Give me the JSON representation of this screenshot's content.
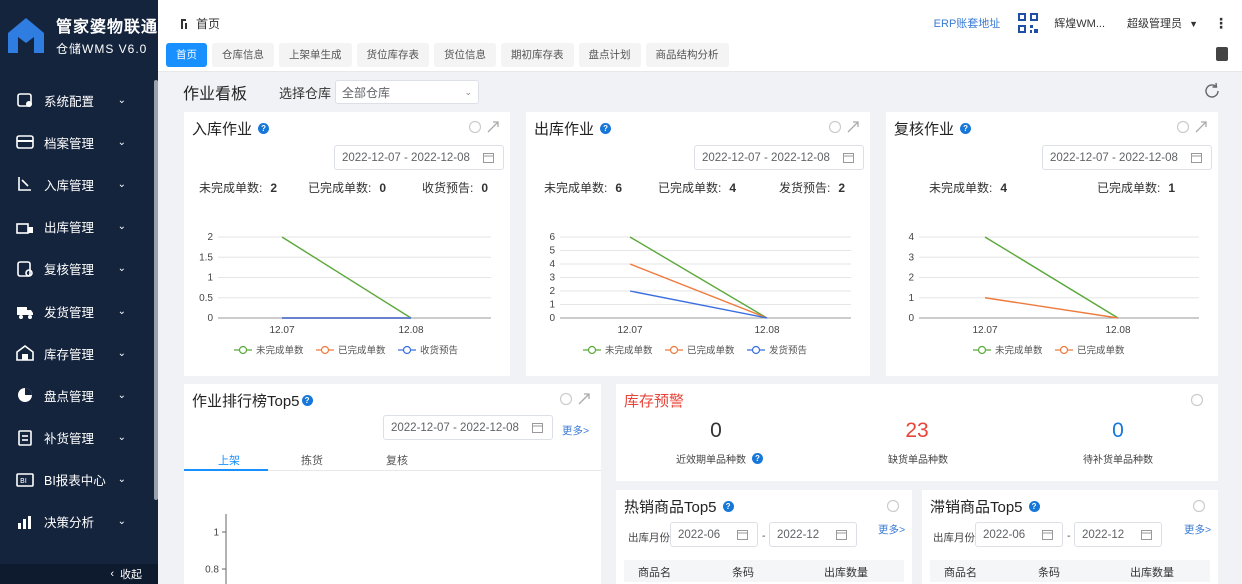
{
  "app": {
    "name": "管家婆物联通",
    "version": "仓储WMS V6.0"
  },
  "sidebar": {
    "items": [
      {
        "label": "系统配置",
        "icon": "settings-icon"
      },
      {
        "label": "档案管理",
        "icon": "archive-icon"
      },
      {
        "label": "入库管理",
        "icon": "inbound-icon"
      },
      {
        "label": "出库管理",
        "icon": "outbound-icon"
      },
      {
        "label": "复核管理",
        "icon": "review-icon"
      },
      {
        "label": "发货管理",
        "icon": "truck-icon"
      },
      {
        "label": "库存管理",
        "icon": "warehouse-icon"
      },
      {
        "label": "盘点管理",
        "icon": "pie-icon"
      },
      {
        "label": "补货管理",
        "icon": "replenish-icon"
      },
      {
        "label": "BI报表中心",
        "icon": "report-icon"
      },
      {
        "label": "决策分析",
        "icon": "bar-icon"
      }
    ],
    "collapse_label": "收起"
  },
  "header": {
    "breadcrumb": "首页",
    "erp_link": "ERP账套地址",
    "user_short": "辉煌WM...",
    "role": "超级管理员"
  },
  "tabs": [
    {
      "label": "首页",
      "active": true
    },
    {
      "label": "仓库信息"
    },
    {
      "label": "上架单生成"
    },
    {
      "label": "货位库存表"
    },
    {
      "label": "货位信息"
    },
    {
      "label": "期初库存表"
    },
    {
      "label": "盘点计划"
    },
    {
      "label": "商品结构分析"
    }
  ],
  "dashboard": {
    "title": "作业看板",
    "warehouse_label": "选择仓库",
    "warehouse_value": "全部仓库"
  },
  "inbound": {
    "title": "入库作业",
    "date_range": "2022-12-07 - 2022-12-08",
    "stats": [
      {
        "label": "未完成单数:",
        "value": "2"
      },
      {
        "label": "已完成单数:",
        "value": "0"
      },
      {
        "label": "收货预告:",
        "value": "0"
      }
    ]
  },
  "outbound": {
    "title": "出库作业",
    "date_range": "2022-12-07 - 2022-12-08",
    "stats": [
      {
        "label": "未完成单数:",
        "value": "6"
      },
      {
        "label": "已完成单数:",
        "value": "4"
      },
      {
        "label": "发货预告:",
        "value": "2"
      }
    ]
  },
  "review": {
    "title": "复核作业",
    "date_range": "2022-12-07 - 2022-12-08",
    "stats": [
      {
        "label": "未完成单数:",
        "value": "4"
      },
      {
        "label": "已完成单数:",
        "value": "1"
      }
    ]
  },
  "chart_data": [
    {
      "type": "line",
      "categories": [
        "12.07",
        "12.08"
      ],
      "ylim": [
        0,
        2
      ],
      "yticks": [
        "0",
        "0.5",
        "1",
        "1.5",
        "2"
      ],
      "series": [
        {
          "name": "未完成单数",
          "values": [
            2,
            0
          ],
          "color": "#5aa83a"
        },
        {
          "name": "已完成单数",
          "values": [
            0,
            0
          ],
          "color": "#ee7b3e"
        },
        {
          "name": "收货预告",
          "values": [
            0,
            0
          ],
          "color": "#3a6fe0"
        }
      ]
    },
    {
      "type": "line",
      "categories": [
        "12.07",
        "12.08"
      ],
      "ylim": [
        0,
        6
      ],
      "yticks": [
        "0",
        "1",
        "2",
        "3",
        "4",
        "5",
        "6"
      ],
      "series": [
        {
          "name": "未完成单数",
          "values": [
            6,
            0
          ],
          "color": "#5aa83a"
        },
        {
          "name": "已完成单数",
          "values": [
            4,
            0
          ],
          "color": "#ee7b3e"
        },
        {
          "name": "发货预告",
          "values": [
            2,
            0
          ],
          "color": "#3a6fe0"
        }
      ]
    },
    {
      "type": "line",
      "categories": [
        "12.07",
        "12.08"
      ],
      "ylim": [
        0,
        4
      ],
      "yticks": [
        "0",
        "1",
        "2",
        "3",
        "4"
      ],
      "series": [
        {
          "name": "未完成单数",
          "values": [
            4,
            0
          ],
          "color": "#5aa83a"
        },
        {
          "name": "已完成单数",
          "values": [
            1,
            0
          ],
          "color": "#ee7b3e"
        }
      ]
    },
    {
      "type": "bar",
      "categories": [],
      "ylim": [
        0.8,
        1
      ],
      "yticks": [
        "0.8",
        "1"
      ],
      "series": []
    }
  ],
  "ranking": {
    "title": "作业排行榜Top5",
    "date_range": "2022-12-07 - 2022-12-08",
    "more": "更多>",
    "tabs": [
      "上架",
      "拣货",
      "复核"
    ]
  },
  "stock_alert": {
    "title": "库存预警",
    "items": [
      {
        "value": "0",
        "label": "近效期单品种数",
        "color": "#333333"
      },
      {
        "value": "23",
        "label": "缺货单品种数",
        "color": "#e8443a"
      },
      {
        "value": "0",
        "label": "待补货单品种数",
        "color": "#1677d8"
      }
    ]
  },
  "hot": {
    "title": "热销商品Top5",
    "month_label": "出库月份",
    "from": "2022-06",
    "to": "2022-12",
    "sep": "-",
    "more": "更多>",
    "columns": [
      "商品名",
      "条码",
      "出库数量"
    ]
  },
  "slow": {
    "title": "滞销商品Top5",
    "month_label": "出库月份",
    "from": "2022-06",
    "to": "2022-12",
    "sep": "-",
    "more": "更多>",
    "columns": [
      "商品名",
      "条码",
      "出库数量"
    ]
  }
}
